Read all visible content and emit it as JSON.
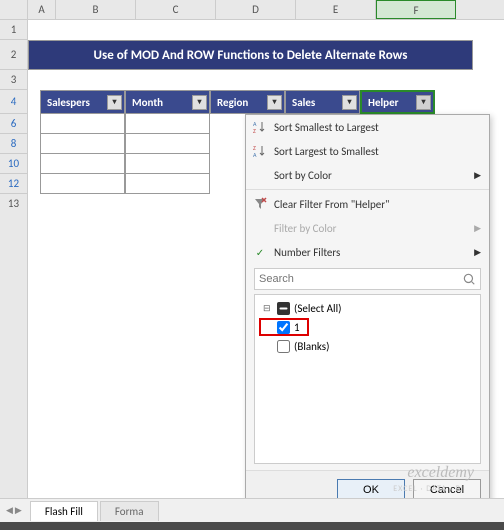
{
  "columns": [
    "A",
    "B",
    "C",
    "D",
    "E",
    "F"
  ],
  "rows": [
    "1",
    "2",
    "3",
    "4",
    "6",
    "8",
    "10",
    "12",
    "13"
  ],
  "title": "Use of MOD And ROW Functions to Delete Alternate Rows",
  "headers": [
    "Salespers",
    "Month",
    "Region",
    "Sales",
    "Helper"
  ],
  "menu": {
    "sort_asc": "Sort Smallest to Largest",
    "sort_desc": "Sort Largest to Smallest",
    "sort_color": "Sort by Color",
    "clear_filter": "Clear Filter From \"Helper\"",
    "filter_color": "Filter by Color",
    "number_filters": "Number Filters",
    "search_placeholder": "Search"
  },
  "tree": {
    "select_all": "(Select All)",
    "opt1": "1",
    "blanks": "(Blanks)"
  },
  "buttons": {
    "ok": "OK",
    "cancel": "Cancel"
  },
  "watermark": "exceldemy",
  "watermark_sub": "EXCEL · DATA · BI",
  "tabs": {
    "active": "Flash Fill",
    "inactive": "Forma"
  }
}
